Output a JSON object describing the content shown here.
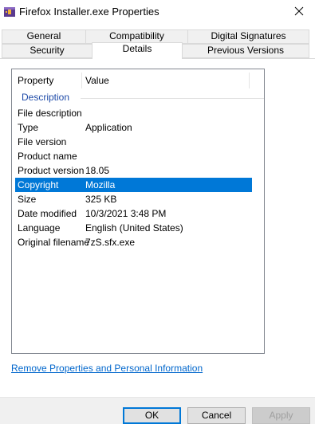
{
  "window": {
    "title": "Firefox Installer.exe Properties"
  },
  "tabs": {
    "general": "General",
    "compatibility": "Compatibility",
    "digital_signatures": "Digital Signatures",
    "security": "Security",
    "details": "Details",
    "previous_versions": "Previous Versions"
  },
  "details": {
    "headers": {
      "property": "Property",
      "value": "Value"
    },
    "group": "Description",
    "rows": [
      {
        "k": "File description",
        "v": ""
      },
      {
        "k": "Type",
        "v": "Application"
      },
      {
        "k": "File version",
        "v": ""
      },
      {
        "k": "Product name",
        "v": ""
      },
      {
        "k": "Product version",
        "v": "18.05"
      },
      {
        "k": "Copyright",
        "v": "Mozilla",
        "selected": true
      },
      {
        "k": "Size",
        "v": "325 KB"
      },
      {
        "k": "Date modified",
        "v": "10/3/2021 3:48 PM"
      },
      {
        "k": "Language",
        "v": "English (United States)"
      },
      {
        "k": "Original filename",
        "v": "7zS.sfx.exe"
      }
    ]
  },
  "link": "Remove Properties and Personal Information",
  "buttons": {
    "ok": "OK",
    "cancel": "Cancel",
    "apply": "Apply"
  },
  "colors": {
    "selection": "#0078d7",
    "group_text": "#1f4ba8",
    "link": "#0066cc"
  }
}
